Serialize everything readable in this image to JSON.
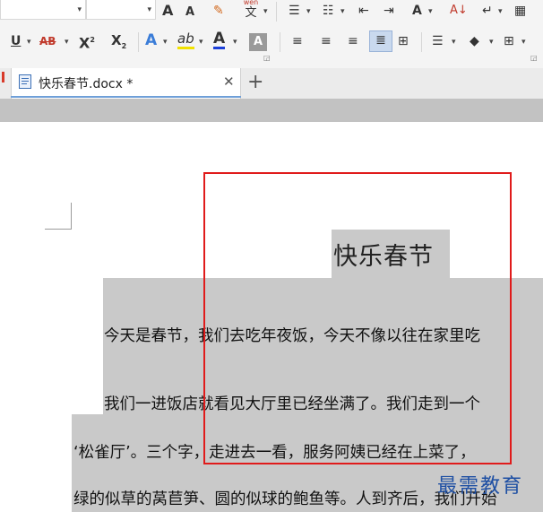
{
  "ribbon": {
    "font_size_grow": "A",
    "font_size_shrink": "A",
    "phonetic_label": "wén",
    "phonetic_char": "文",
    "sort_label": "A↓",
    "underline": "U",
    "strikethrough": "AB",
    "superscript": "X",
    "superscript_mark": "2",
    "subscript": "X",
    "subscript_mark": "2",
    "text_effect": "A",
    "highlight": "ab",
    "font_color": "A",
    "char_shading": "A"
  },
  "tab": {
    "title": "快乐春节.docx *"
  },
  "document": {
    "title": "快乐春节",
    "lines": [
      "今天是春节，我们去吃年夜饭，今天不像以往在家里吃",
      "我们一进饭店就看见大厅里已经坐满了。我们走到一个",
      "‘松雀厅’。三个字，走进去一看，服务阿姨已经在上菜了，",
      "绿的似草的莴苣笋、圆的似球的鲍鱼等。人到齐后，我们开始"
    ]
  },
  "watermark": {
    "text": "最需教育"
  },
  "colors": {
    "highlight": "#c9c9c9",
    "annotation": "#e01b1b",
    "watermark": "#1e4fa3",
    "tab_accent": "#6f9fd8"
  }
}
